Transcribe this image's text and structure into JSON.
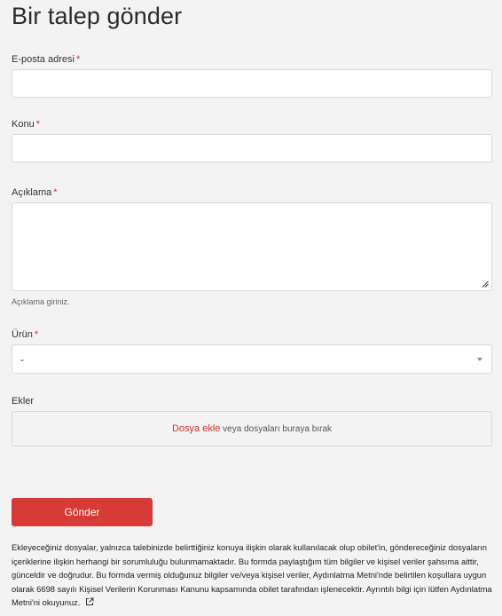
{
  "form": {
    "title": "Bir talep gönder",
    "required_mark": "*",
    "email": {
      "label": "E-posta adresi",
      "value": "",
      "placeholder": ""
    },
    "subject": {
      "label": "Konu",
      "value": "",
      "placeholder": ""
    },
    "description": {
      "label": "Açıklama",
      "value": "",
      "hint": "Açıklama giriniz."
    },
    "product": {
      "label": "Ürün",
      "selected": "-"
    },
    "attachments": {
      "label": "Ekler",
      "add_link": "Dosya ekle",
      "drop_text": "veya dosyaları buraya bırak"
    },
    "submit_label": "Gönder",
    "disclaimer": "Ekleyeceğiniz dosyalar, yalnızca talebinizde belirttiğiniz konuya ilişkin olarak kullanılacak olup obilet'in, göndereceğiniz dosyaların içeriklerine ilişkin herhangi bir sorumluluğu bulunmamaktadır. Bu formda paylaştığım tüm bilgiler ve kişisel veriler şahsıma aittir, günceldir ve doğrudur. Bu formda vermiş olduğunuz bilgiler ve/veya kişisel veriler, Aydınlatma Metni'nde belirtilen koşullara uygun olarak 6698 sayılı Kişisel Verilerin Korunması Kanunu kapsamında obilet tarafından işlenecektir. Ayrıntılı bilgi için lütfen Aydınlatma Metni'ni okuyunuz."
  },
  "colors": {
    "accent": "#d63b37",
    "background": "#f3f3f3",
    "field_border": "#d9d9d9"
  },
  "icons": {
    "external_link": "external-link-icon",
    "select_arrow": "caret-down-icon",
    "resize": "resize-handle-icon"
  }
}
